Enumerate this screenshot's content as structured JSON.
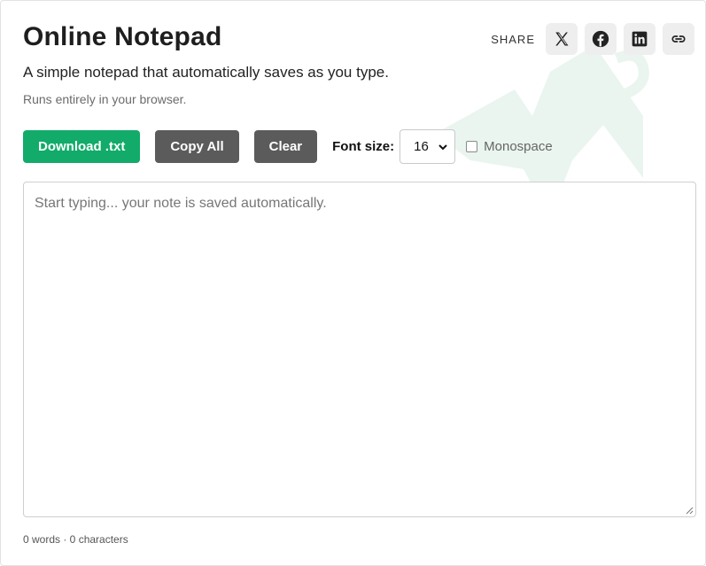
{
  "app": {
    "title": "Online Notepad",
    "subtitle": "A simple notepad that automatically saves as you type.",
    "note": "Runs entirely in your browser."
  },
  "share": {
    "label": "SHARE",
    "items": [
      {
        "name": "x",
        "icon": "x-icon"
      },
      {
        "name": "facebook",
        "icon": "facebook-icon"
      },
      {
        "name": "linkedin",
        "icon": "linkedin-icon"
      },
      {
        "name": "link",
        "icon": "link-icon"
      }
    ]
  },
  "toolbar": {
    "download_label": "Download .txt",
    "copy_label": "Copy All",
    "clear_label": "Clear",
    "font_size_label": "Font size:",
    "font_size_value": "16",
    "monospace_label": "Monospace",
    "monospace_checked": false
  },
  "editor": {
    "placeholder": "Start typing... your note is saved automatically.",
    "value": ""
  },
  "stats": {
    "text": "0 words · 0 characters"
  },
  "colors": {
    "primary": "#12ab6a",
    "secondary_button": "#5b5b5b",
    "watermark": "#eaf5ef"
  }
}
